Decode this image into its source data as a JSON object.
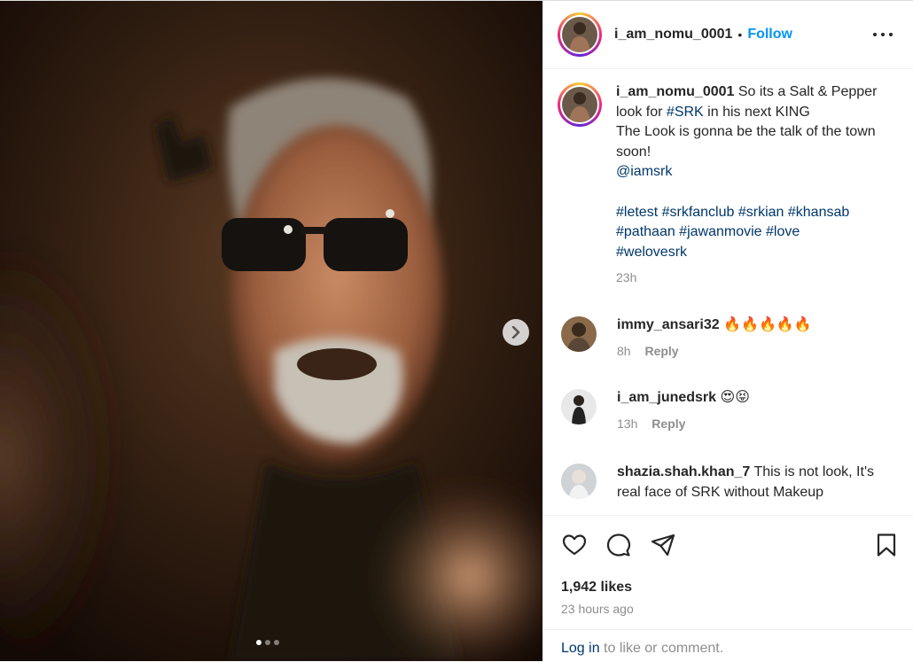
{
  "post": {
    "username": "i_am_nomu_0001",
    "separator": "•",
    "follow_label": "Follow",
    "caption": {
      "username": "i_am_nomu_0001",
      "line1": "So its a Salt & Pepper look for",
      "srk_tag": "#SRK",
      "line1b": "in his next KING",
      "line2": "The Look is gonna be the talk of the town soon!",
      "mention": "@iamsrk",
      "hashtags1": "#letest #srkfanclub #srkian #khansab",
      "hashtags2": "#pathaan #jawanmovie #love",
      "hashtags3": "#welovesrk",
      "time": "23h"
    },
    "comments": [
      {
        "username": "immy_ansari32",
        "text": "🔥🔥🔥🔥🔥",
        "time": "8h",
        "reply": "Reply"
      },
      {
        "username": "i_am_junedsrk",
        "text": "😍😝",
        "time": "13h",
        "reply": "Reply"
      },
      {
        "username": "shazia.shah.khan_7",
        "text": "This is not look, It's real face of SRK without Makeup"
      }
    ],
    "likes": "1,942 likes",
    "posted_ago": "23 hours ago",
    "login": {
      "link": "Log in",
      "rest": " to like or comment."
    }
  },
  "carousel": {
    "total": 3,
    "active": 1
  },
  "icons": {
    "more": "more-options-icon",
    "next": "chevron-right-icon",
    "like": "heart-icon",
    "comment": "comment-icon",
    "share": "share-icon",
    "save": "bookmark-icon"
  },
  "colors": {
    "accent": "#0095f6",
    "link": "#00376b",
    "muted": "#8e8e8e",
    "text": "#262626"
  }
}
